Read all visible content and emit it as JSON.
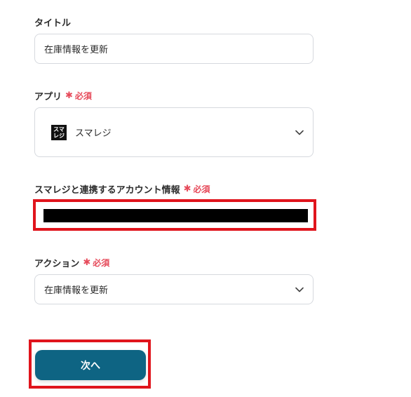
{
  "title_section": {
    "label": "タイトル",
    "value": "在庫情報を更新"
  },
  "app_section": {
    "label": "アプリ",
    "required": "必須",
    "selected_app": "スマレジ",
    "app_icon_top": "スマ",
    "app_icon_bottom": "レジ"
  },
  "account_section": {
    "label": "スマレジと連携するアカウント情報",
    "required": "必須"
  },
  "action_section": {
    "label": "アクション",
    "required": "必須",
    "selected_action": "在庫情報を更新"
  },
  "next_button": {
    "label": "次へ"
  },
  "colors": {
    "required": "#e64a5a",
    "button": "#0e6483",
    "highlight": "#e0141c"
  }
}
